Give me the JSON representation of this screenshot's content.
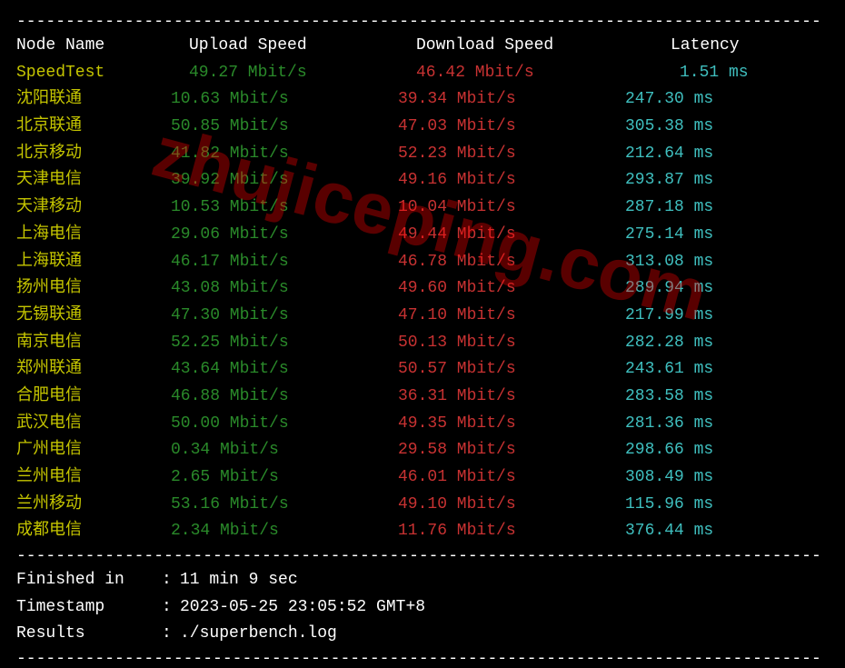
{
  "divider": "----------------------------------------------------------------------------------",
  "headers": {
    "node": "Node Name",
    "upload": "Upload Speed",
    "download": "Download Speed",
    "latency": "Latency"
  },
  "speedtest": {
    "name": "SpeedTest",
    "upload": "49.27 Mbit/s",
    "download": "46.42 Mbit/s",
    "latency": "1.51 ms"
  },
  "rows": [
    {
      "name": "沈阳联通",
      "upload": "10.63 Mbit/s",
      "download": "39.34 Mbit/s",
      "latency": "247.30 ms"
    },
    {
      "name": "北京联通",
      "upload": "50.85 Mbit/s",
      "download": "47.03 Mbit/s",
      "latency": "305.38 ms"
    },
    {
      "name": "北京移动",
      "upload": "41.82 Mbit/s",
      "download": "52.23 Mbit/s",
      "latency": "212.64 ms"
    },
    {
      "name": "天津电信",
      "upload": "39.92 Mbit/s",
      "download": "49.16 Mbit/s",
      "latency": "293.87 ms"
    },
    {
      "name": "天津移动",
      "upload": "10.53 Mbit/s",
      "download": "10.04 Mbit/s",
      "latency": "287.18 ms"
    },
    {
      "name": "上海电信",
      "upload": "29.06 Mbit/s",
      "download": "49.44 Mbit/s",
      "latency": "275.14 ms"
    },
    {
      "name": "上海联通",
      "upload": "46.17 Mbit/s",
      "download": "46.78 Mbit/s",
      "latency": "313.08 ms"
    },
    {
      "name": "扬州电信",
      "upload": "43.08 Mbit/s",
      "download": "49.60 Mbit/s",
      "latency": "289.94 ms"
    },
    {
      "name": "无锡联通",
      "upload": "47.30 Mbit/s",
      "download": "47.10 Mbit/s",
      "latency": "217.99 ms"
    },
    {
      "name": "南京电信",
      "upload": "52.25 Mbit/s",
      "download": "50.13 Mbit/s",
      "latency": "282.28 ms"
    },
    {
      "name": "郑州联通",
      "upload": "43.64 Mbit/s",
      "download": "50.57 Mbit/s",
      "latency": "243.61 ms"
    },
    {
      "name": "合肥电信",
      "upload": "46.88 Mbit/s",
      "download": "36.31 Mbit/s",
      "latency": "283.58 ms"
    },
    {
      "name": "武汉电信",
      "upload": "50.00 Mbit/s",
      "download": "49.35 Mbit/s",
      "latency": "281.36 ms"
    },
    {
      "name": "广州电信",
      "upload": "0.34 Mbit/s",
      "download": "29.58 Mbit/s",
      "latency": "298.66 ms"
    },
    {
      "name": "兰州电信",
      "upload": "2.65 Mbit/s",
      "download": "46.01 Mbit/s",
      "latency": "308.49 ms"
    },
    {
      "name": "兰州移动",
      "upload": "53.16 Mbit/s",
      "download": "49.10 Mbit/s",
      "latency": "115.96 ms"
    },
    {
      "name": "成都电信",
      "upload": "2.34 Mbit/s",
      "download": "11.76 Mbit/s",
      "latency": "376.44 ms"
    }
  ],
  "footer": {
    "finished_label": "Finished in",
    "finished_value": "11 min 9 sec",
    "timestamp_label": "Timestamp",
    "timestamp_value": "2023-05-25 23:05:52 GMT+8",
    "results_label": "Results",
    "results_value": "./superbench.log",
    "separator": ":"
  },
  "watermark": "zhujiceping.com"
}
